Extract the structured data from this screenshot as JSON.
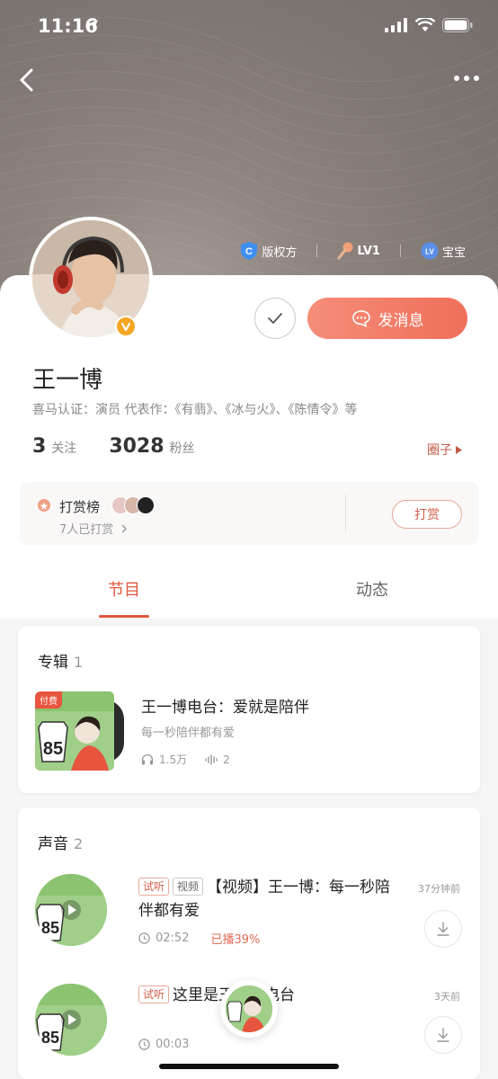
{
  "status_bar": {
    "time": "11:16"
  },
  "profile": {
    "name": "王一博",
    "certification": "喜马认证：演员  代表作：《有翡》、《冰与火》、《陈情令》等",
    "badges": [
      {
        "icon": "copyright-shield-icon",
        "label": "版权方"
      },
      {
        "icon": "microphone-icon",
        "label": "LV1"
      },
      {
        "icon": "baby-level-icon",
        "label": "宝宝"
      }
    ],
    "message_button": "发消息",
    "following_count": "3",
    "following_label": "关注",
    "fans_count": "3028",
    "fans_label": "粉丝",
    "circle_link": "圈子"
  },
  "reward": {
    "title": "打赏榜",
    "count_text": "7人已打赏",
    "button": "打赏"
  },
  "tabs": [
    {
      "label": "节目",
      "active": true
    },
    {
      "label": "动态",
      "active": false
    }
  ],
  "album_section": {
    "title": "专辑",
    "count": "1",
    "item": {
      "pay_tag": "付费",
      "title": "王一博电台：爱就是陪伴",
      "subtitle": "每一秒陪伴都有爱",
      "plays": "1.5万",
      "tracks": "2"
    }
  },
  "sound_section": {
    "title": "声音",
    "count": "2",
    "items": [
      {
        "tags": [
          "试听",
          "视频"
        ],
        "title": "【视频】王一博：每一秒陪伴都有爱",
        "time_ago": "37分钟前",
        "duration": "02:52",
        "played": "已播39%"
      },
      {
        "tags": [
          "试听"
        ],
        "title": "这里是王一博电台",
        "time_ago": "3天前",
        "duration": "00:03",
        "played": ""
      }
    ]
  },
  "colors": {
    "accent": "#e0573d",
    "button_gradient_start": "#f58d79",
    "button_gradient_end": "#ef6f5a",
    "hero_bg": "#857c78"
  }
}
